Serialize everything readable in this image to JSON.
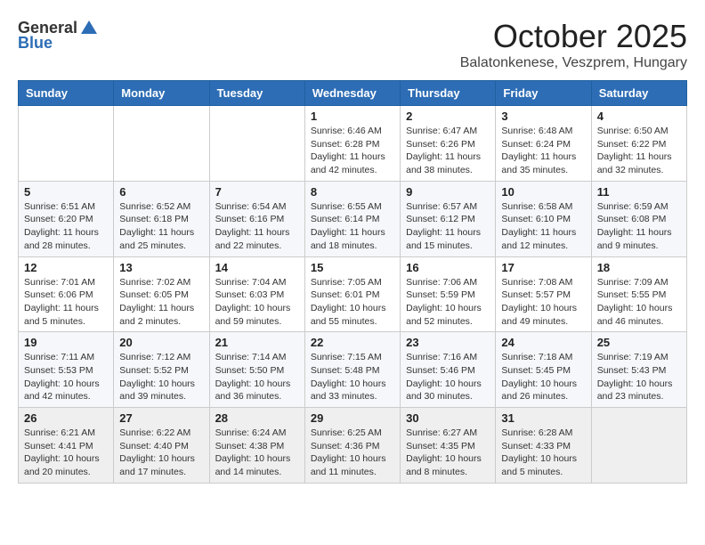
{
  "header": {
    "logo_general": "General",
    "logo_blue": "Blue",
    "month_title": "October 2025",
    "subtitle": "Balatonkenese, Veszprem, Hungary"
  },
  "weekdays": [
    "Sunday",
    "Monday",
    "Tuesday",
    "Wednesday",
    "Thursday",
    "Friday",
    "Saturday"
  ],
  "weeks": [
    [
      {
        "day": "",
        "info": ""
      },
      {
        "day": "",
        "info": ""
      },
      {
        "day": "",
        "info": ""
      },
      {
        "day": "1",
        "info": "Sunrise: 6:46 AM\nSunset: 6:28 PM\nDaylight: 11 hours\nand 42 minutes."
      },
      {
        "day": "2",
        "info": "Sunrise: 6:47 AM\nSunset: 6:26 PM\nDaylight: 11 hours\nand 38 minutes."
      },
      {
        "day": "3",
        "info": "Sunrise: 6:48 AM\nSunset: 6:24 PM\nDaylight: 11 hours\nand 35 minutes."
      },
      {
        "day": "4",
        "info": "Sunrise: 6:50 AM\nSunset: 6:22 PM\nDaylight: 11 hours\nand 32 minutes."
      }
    ],
    [
      {
        "day": "5",
        "info": "Sunrise: 6:51 AM\nSunset: 6:20 PM\nDaylight: 11 hours\nand 28 minutes."
      },
      {
        "day": "6",
        "info": "Sunrise: 6:52 AM\nSunset: 6:18 PM\nDaylight: 11 hours\nand 25 minutes."
      },
      {
        "day": "7",
        "info": "Sunrise: 6:54 AM\nSunset: 6:16 PM\nDaylight: 11 hours\nand 22 minutes."
      },
      {
        "day": "8",
        "info": "Sunrise: 6:55 AM\nSunset: 6:14 PM\nDaylight: 11 hours\nand 18 minutes."
      },
      {
        "day": "9",
        "info": "Sunrise: 6:57 AM\nSunset: 6:12 PM\nDaylight: 11 hours\nand 15 minutes."
      },
      {
        "day": "10",
        "info": "Sunrise: 6:58 AM\nSunset: 6:10 PM\nDaylight: 11 hours\nand 12 minutes."
      },
      {
        "day": "11",
        "info": "Sunrise: 6:59 AM\nSunset: 6:08 PM\nDaylight: 11 hours\nand 9 minutes."
      }
    ],
    [
      {
        "day": "12",
        "info": "Sunrise: 7:01 AM\nSunset: 6:06 PM\nDaylight: 11 hours\nand 5 minutes."
      },
      {
        "day": "13",
        "info": "Sunrise: 7:02 AM\nSunset: 6:05 PM\nDaylight: 11 hours\nand 2 minutes."
      },
      {
        "day": "14",
        "info": "Sunrise: 7:04 AM\nSunset: 6:03 PM\nDaylight: 10 hours\nand 59 minutes."
      },
      {
        "day": "15",
        "info": "Sunrise: 7:05 AM\nSunset: 6:01 PM\nDaylight: 10 hours\nand 55 minutes."
      },
      {
        "day": "16",
        "info": "Sunrise: 7:06 AM\nSunset: 5:59 PM\nDaylight: 10 hours\nand 52 minutes."
      },
      {
        "day": "17",
        "info": "Sunrise: 7:08 AM\nSunset: 5:57 PM\nDaylight: 10 hours\nand 49 minutes."
      },
      {
        "day": "18",
        "info": "Sunrise: 7:09 AM\nSunset: 5:55 PM\nDaylight: 10 hours\nand 46 minutes."
      }
    ],
    [
      {
        "day": "19",
        "info": "Sunrise: 7:11 AM\nSunset: 5:53 PM\nDaylight: 10 hours\nand 42 minutes."
      },
      {
        "day": "20",
        "info": "Sunrise: 7:12 AM\nSunset: 5:52 PM\nDaylight: 10 hours\nand 39 minutes."
      },
      {
        "day": "21",
        "info": "Sunrise: 7:14 AM\nSunset: 5:50 PM\nDaylight: 10 hours\nand 36 minutes."
      },
      {
        "day": "22",
        "info": "Sunrise: 7:15 AM\nSunset: 5:48 PM\nDaylight: 10 hours\nand 33 minutes."
      },
      {
        "day": "23",
        "info": "Sunrise: 7:16 AM\nSunset: 5:46 PM\nDaylight: 10 hours\nand 30 minutes."
      },
      {
        "day": "24",
        "info": "Sunrise: 7:18 AM\nSunset: 5:45 PM\nDaylight: 10 hours\nand 26 minutes."
      },
      {
        "day": "25",
        "info": "Sunrise: 7:19 AM\nSunset: 5:43 PM\nDaylight: 10 hours\nand 23 minutes."
      }
    ],
    [
      {
        "day": "26",
        "info": "Sunrise: 6:21 AM\nSunset: 4:41 PM\nDaylight: 10 hours\nand 20 minutes."
      },
      {
        "day": "27",
        "info": "Sunrise: 6:22 AM\nSunset: 4:40 PM\nDaylight: 10 hours\nand 17 minutes."
      },
      {
        "day": "28",
        "info": "Sunrise: 6:24 AM\nSunset: 4:38 PM\nDaylight: 10 hours\nand 14 minutes."
      },
      {
        "day": "29",
        "info": "Sunrise: 6:25 AM\nSunset: 4:36 PM\nDaylight: 10 hours\nand 11 minutes."
      },
      {
        "day": "30",
        "info": "Sunrise: 6:27 AM\nSunset: 4:35 PM\nDaylight: 10 hours\nand 8 minutes."
      },
      {
        "day": "31",
        "info": "Sunrise: 6:28 AM\nSunset: 4:33 PM\nDaylight: 10 hours\nand 5 minutes."
      },
      {
        "day": "",
        "info": ""
      }
    ]
  ]
}
